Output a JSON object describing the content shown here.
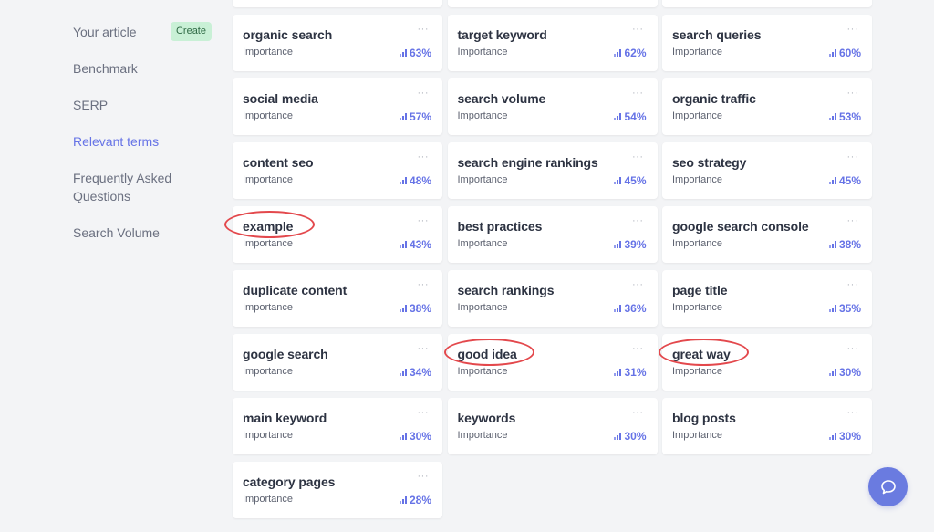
{
  "sidebar": {
    "items": [
      {
        "label": "Your article",
        "badge": "Create",
        "active": false
      },
      {
        "label": "Benchmark",
        "active": false
      },
      {
        "label": "SERP",
        "active": false
      },
      {
        "label": "Relevant terms",
        "active": true
      },
      {
        "label": "Frequently Asked Questions",
        "active": false
      },
      {
        "label": "Search Volume",
        "active": false
      }
    ]
  },
  "cards_label": "Importance",
  "more_icon": "more-horizontal-icon",
  "score_icon": "bar-chart-icon",
  "terms": [
    {
      "term": "",
      "score": ""
    },
    {
      "term": "",
      "score": ""
    },
    {
      "term": "",
      "score": ""
    },
    {
      "term": "organic search",
      "score": "63%"
    },
    {
      "term": "target keyword",
      "score": "62%"
    },
    {
      "term": "search queries",
      "score": "60%"
    },
    {
      "term": "social media",
      "score": "57%"
    },
    {
      "term": "search volume",
      "score": "54%"
    },
    {
      "term": "organic traffic",
      "score": "53%"
    },
    {
      "term": "content seo",
      "score": "48%"
    },
    {
      "term": "search engine rankings",
      "score": "45%"
    },
    {
      "term": "seo strategy",
      "score": "45%"
    },
    {
      "term": "example",
      "score": "43%",
      "circled": true
    },
    {
      "term": "best practices",
      "score": "39%"
    },
    {
      "term": "google search console",
      "score": "38%"
    },
    {
      "term": "duplicate content",
      "score": "38%"
    },
    {
      "term": "search rankings",
      "score": "36%"
    },
    {
      "term": "page title",
      "score": "35%"
    },
    {
      "term": "google search",
      "score": "34%"
    },
    {
      "term": "good idea",
      "score": "31%",
      "circled": true
    },
    {
      "term": "great way",
      "score": "30%",
      "circled": true
    },
    {
      "term": "main keyword",
      "score": "30%"
    },
    {
      "term": "keywords",
      "score": "30%"
    },
    {
      "term": "blog posts",
      "score": "30%"
    },
    {
      "term": "category pages",
      "score": "28%"
    }
  ],
  "colors": {
    "accent": "#6673e6",
    "annotation": "#e3484c",
    "badge_bg": "#c9f0d6",
    "chat_button": "#6a7be0"
  },
  "chat_button_icon": "chat-bubble-icon"
}
